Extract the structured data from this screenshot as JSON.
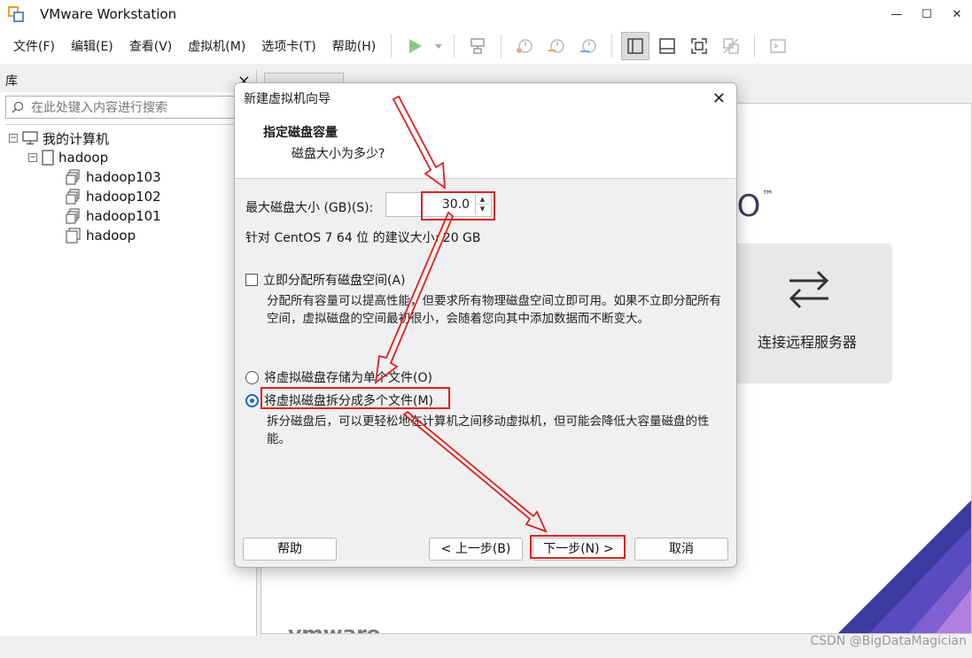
{
  "window": {
    "title": "VMware Workstation"
  },
  "menu": [
    "文件(F)",
    "编辑(E)",
    "查看(V)",
    "虚拟机(M)",
    "选项卡(T)",
    "帮助(H)"
  ],
  "library": {
    "title": "库",
    "close": "×",
    "search_placeholder": "在此处键入内容进行搜索",
    "tree": {
      "root": "我的计算机",
      "folder": "hadoop",
      "vms": [
        "hadoop103",
        "hadoop102",
        "hadoop101"
      ],
      "leaf": "hadoop"
    }
  },
  "home": {
    "brand_suffix": "RO",
    "tm": "™",
    "remote_label": "连接远程服务器",
    "logo": "vmware"
  },
  "dialog": {
    "title": "新建虚拟机向导",
    "heading": "指定磁盘容量",
    "subheading": "磁盘大小为多少?",
    "size_label": "最大磁盘大小 (GB)(S):",
    "size_value": "30.0",
    "recommend": "针对 CentOS 7 64 位 的建议大小: 20 GB",
    "allocate_label": "立即分配所有磁盘空间(A)",
    "allocate_checked": false,
    "allocate_desc": "分配所有容量可以提高性能，但要求所有物理磁盘空间立即可用。如果不立即分配所有空间，虚拟磁盘的空间最初很小，会随着您向其中添加数据而不断变大。",
    "single_label": "将虚拟磁盘存储为单个文件(O)",
    "split_label": "将虚拟磁盘拆分成多个文件(M)",
    "selected": "split",
    "split_desc": "拆分磁盘后，可以更轻松地在计算机之间移动虚拟机，但可能会降低大容量磁盘的性能。",
    "buttons": {
      "help": "帮助",
      "back": "< 上一步(B)",
      "next": "下一步(N) >",
      "cancel": "取消"
    }
  },
  "watermark": "CSDN @BigDataMagician",
  "colors": {
    "annotation": "#e02020",
    "accent": "#1565c0",
    "play": "#4caf50"
  }
}
